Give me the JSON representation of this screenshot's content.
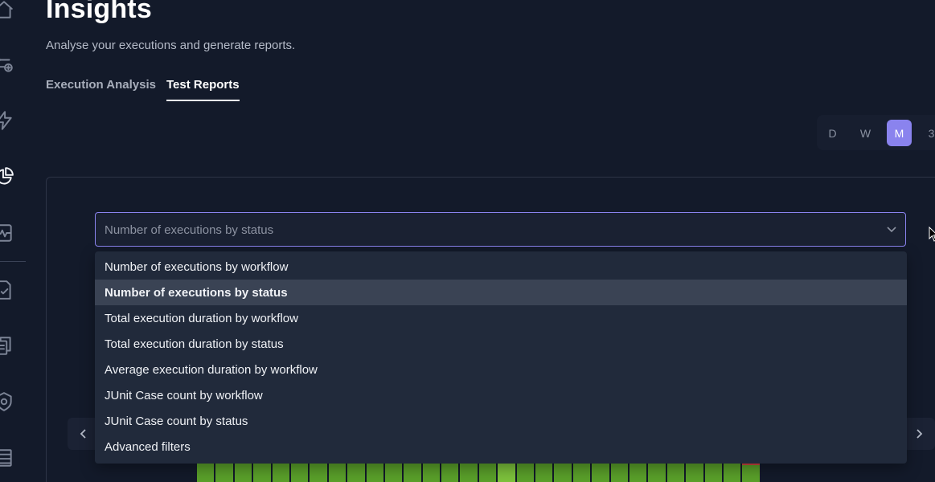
{
  "header": {
    "title": "Insights",
    "subtitle": "Analyse your executions and generate reports."
  },
  "tabs": [
    {
      "label": "Execution Analysis",
      "active": false
    },
    {
      "label": "Test Reports",
      "active": true
    }
  ],
  "period_selector": {
    "options": [
      "D",
      "W",
      "M",
      "3"
    ],
    "selected": "M"
  },
  "report_select": {
    "value": "Number of executions by status",
    "options": [
      "Number of executions by workflow",
      "Number of executions by status",
      "Total execution duration by workflow",
      "Total execution duration by status",
      "Average execution duration by workflow",
      "JUnit Case count by workflow",
      "JUnit Case count by status",
      "Advanced filters"
    ]
  },
  "sidebar": {
    "icons": [
      "home-icon",
      "workflow-add-icon",
      "lightning-icon",
      "pie-chart-icon",
      "monitor-pulse-icon",
      "checklist-icon",
      "copy-files-icon",
      "shield-gear-icon",
      "list-icon"
    ],
    "active": "pie-chart-icon"
  },
  "colors": {
    "accent": "#8a83ee",
    "background": "#131a2a",
    "menu": "#212a3b",
    "bar_passed": "#5aa02a",
    "bar_failed": "#d0453f"
  }
}
